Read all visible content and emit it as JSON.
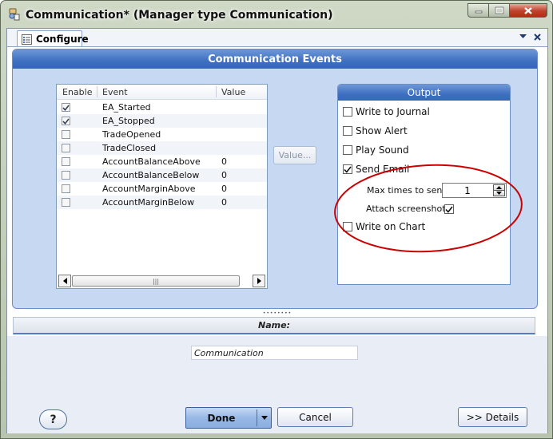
{
  "window": {
    "title": "Communication* (Manager type Communication)",
    "icon": "app-icon",
    "controls": [
      "minimize-icon",
      "maximize-icon",
      "close-icon"
    ]
  },
  "tab": {
    "label": "Configure",
    "icon": "configure-icon",
    "tools": [
      "dropdown-arrow-icon",
      "close-icon"
    ]
  },
  "events_panel": {
    "title": "Communication Events",
    "columns": [
      "Enable",
      "Event",
      "Value"
    ],
    "rows": [
      {
        "enabled": true,
        "event": "EA_Started",
        "value": ""
      },
      {
        "enabled": true,
        "event": "EA_Stopped",
        "value": ""
      },
      {
        "enabled": false,
        "event": "TradeOpened",
        "value": ""
      },
      {
        "enabled": false,
        "event": "TradeClosed",
        "value": ""
      },
      {
        "enabled": false,
        "event": "AccountBalanceAbove",
        "value": "0"
      },
      {
        "enabled": false,
        "event": "AccountBalanceBelow",
        "value": "0"
      },
      {
        "enabled": false,
        "event": "AccountMarginAbove",
        "value": "0"
      },
      {
        "enabled": false,
        "event": "AccountMarginBelow",
        "value": "0"
      }
    ],
    "scroll_grip": "|||",
    "value_button": "Value..."
  },
  "output": {
    "title": "Output",
    "options": [
      {
        "label": "Write to Journal",
        "checked": false
      },
      {
        "label": "Show Alert",
        "checked": false
      },
      {
        "label": "Play Sound",
        "checked": false
      },
      {
        "label": "Send Email",
        "checked": true
      },
      {
        "label": "Write on Chart",
        "checked": false
      }
    ],
    "max_times_label": "Max times to send",
    "max_times_value": "1",
    "attach_label": "Attach screenshot",
    "attach_checked": true,
    "highlight_color": "#cc0000"
  },
  "name_section": {
    "label": "Name:",
    "value": "Communication"
  },
  "footer": {
    "help": "?",
    "done": "Done",
    "cancel": "Cancel",
    "details": ">> Details"
  },
  "colors": {
    "header_blue": "#3f6fc0",
    "panel_blue": "#c6d8f2",
    "accent_line": "#4e7ed1"
  }
}
